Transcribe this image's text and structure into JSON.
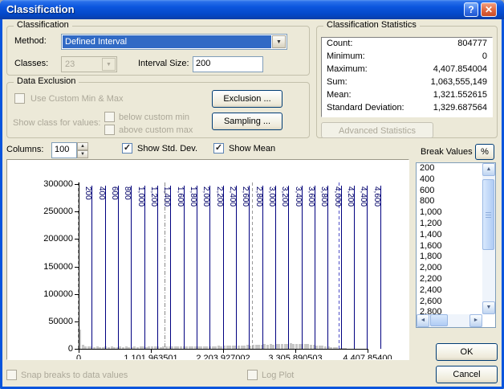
{
  "window": {
    "title": "Classification"
  },
  "icons": {
    "help": "?",
    "close": "✕",
    "combo_arrow": "▼",
    "spinner_up": "▲",
    "spinner_down": "▼",
    "scroll_up": "▲",
    "scroll_down": "▼",
    "scroll_left": "◄",
    "scroll_right": "►",
    "check": "✓"
  },
  "colors": {
    "titlebar_blue": "#0C56DE",
    "selection_blue": "#316AC5",
    "break_line_navy": "#000080",
    "bar_gray": "#C6C6C6",
    "dialog_beige": "#ECE9D8",
    "mean_line_gray": "#8A8A8A",
    "stddev_line_gray": "#9A9A9A",
    "stddev2_line_blue": "#5050C8"
  },
  "classification": {
    "legend": "Classification",
    "method_label": "Method:",
    "method_value": "Defined Interval",
    "classes_label": "Classes:",
    "classes_value": "23",
    "interval_label": "Interval Size:",
    "interval_value": "200"
  },
  "statistics": {
    "legend": "Classification Statistics",
    "rows": [
      {
        "label": "Count:",
        "value": "804777"
      },
      {
        "label": "Minimum:",
        "value": "0"
      },
      {
        "label": "Maximum:",
        "value": "4,407.854004"
      },
      {
        "label": "Sum:",
        "value": "1,063,555,149"
      },
      {
        "label": "Mean:",
        "value": "1,321.552615"
      },
      {
        "label": "Standard Deviation:",
        "value": "1,329.687564"
      }
    ],
    "advanced_button": "Advanced Statistics"
  },
  "exclusion": {
    "legend": "Data Exclusion",
    "use_custom_label": "Use Custom Min & Max",
    "show_class_label": "Show class for values:",
    "below_label": "below custom min",
    "above_label": "above custom max",
    "exclusion_button": "Exclusion ...",
    "sampling_button": "Sampling ..."
  },
  "columns_bar": {
    "label": "Columns:",
    "value": "100",
    "show_std_label": "Show Std. Dev.",
    "show_std_checked": true,
    "show_mean_label": "Show Mean",
    "show_mean_checked": true
  },
  "break_values_panel": {
    "label": "Break Values",
    "percent_button": "%",
    "visible_values": [
      "200",
      "400",
      "600",
      "800",
      "1,000",
      "1,200",
      "1,400",
      "1,600",
      "1,800",
      "2,000",
      "2,200",
      "2,400",
      "2,600",
      "2,800"
    ]
  },
  "footer": {
    "snap_label": "Snap breaks to data values",
    "snap_checked": false,
    "log_label": "Log Plot",
    "log_checked": false,
    "ok": "OK",
    "cancel": "Cancel"
  },
  "chart_data": {
    "type": "bar",
    "title": "",
    "x_axis": {
      "min": 0,
      "max": 4407.854,
      "tick_values": [
        0,
        1101.963501,
        2203.927002,
        3305.890503,
        4407.854
      ],
      "tick_labels": [
        "0",
        "1,101.963501",
        "2,203.927002",
        "3,305.890503",
        "4,407.85400"
      ]
    },
    "y_axis": {
      "min": 0,
      "max": 300000,
      "tick_values": [
        0,
        50000,
        100000,
        150000,
        200000,
        250000,
        300000
      ],
      "tick_labels": [
        "0",
        "50000",
        "100000",
        "150000",
        "200000",
        "250000",
        "300000"
      ]
    },
    "break_lines": {
      "values": [
        200,
        400,
        600,
        800,
        1000,
        1200,
        1400,
        1600,
        1800,
        2000,
        2200,
        2400,
        2600,
        2800,
        3000,
        3200,
        3400,
        3600,
        3800,
        4000,
        4200,
        4400,
        4600
      ],
      "labels": [
        "200",
        "400",
        "600",
        "800",
        "1,000",
        "1,200",
        "1,400",
        "1,600",
        "1,800",
        "2,000",
        "2,200",
        "2,400",
        "2,600",
        "2,800",
        "3,000",
        "3,200",
        "3,400",
        "3,600",
        "3,800",
        "4,000",
        "4,200",
        "4,400",
        "4,600"
      ]
    },
    "stat_lines": [
      {
        "name": "mean",
        "value": 1321.552615,
        "style": "dashdot",
        "color": "#8A8A8A"
      },
      {
        "name": "mean-minus-1-stddev",
        "value": 0,
        "style": "dashed",
        "color": "#9A9A9A"
      },
      {
        "name": "mean-plus-1-stddev",
        "value": 2651.240179,
        "style": "dashed",
        "color": "#9A9A9A"
      },
      {
        "name": "mean-plus-2-stddev",
        "value": 3980.927743,
        "style": "dashed",
        "color": "#5050C8"
      }
    ],
    "bins": {
      "count": 100,
      "bin_width": 44.07854,
      "values": [
        35500,
        7200,
        4300,
        3700,
        3900,
        3400,
        3800,
        3500,
        3300,
        3700,
        3500,
        3900,
        3600,
        3300,
        3800,
        3500,
        4000,
        3600,
        3400,
        3900,
        3600,
        4100,
        3700,
        3500,
        4000,
        3700,
        4200,
        3800,
        3600,
        4100,
        3800,
        4300,
        3900,
        3700,
        4200,
        3900,
        4400,
        4100,
        3800,
        4300,
        4500,
        4200,
        4700,
        4400,
        4900,
        4600,
        5100,
        4800,
        5300,
        5000,
        5500,
        5200,
        5700,
        5400,
        5900,
        6100,
        6400,
        6200,
        6900,
        6500,
        7300,
        6900,
        7700,
        7200,
        8100,
        7500,
        8700,
        7900,
        9300,
        8300,
        8900,
        9500,
        8700,
        9900,
        8900,
        9300,
        8500,
        8900,
        8100,
        8500,
        7700,
        7100,
        6500,
        5900,
        5300,
        4700,
        4100,
        3500,
        2900,
        2300,
        1800,
        1400,
        1000,
        700,
        500,
        350,
        250,
        180,
        120,
        90
      ]
    }
  }
}
